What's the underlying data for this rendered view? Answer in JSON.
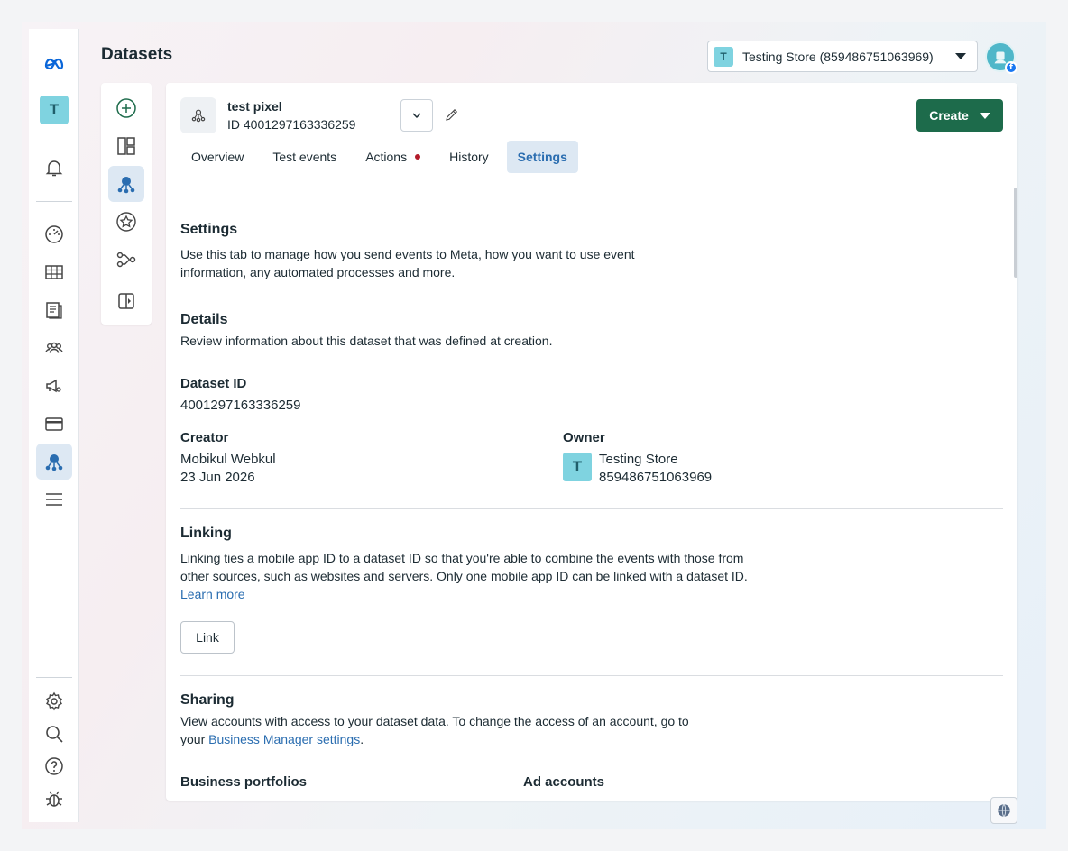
{
  "header": {
    "title": "Datasets",
    "store_selector": "Testing Store (859486751063969)",
    "store_initial": "T"
  },
  "leftnav": {
    "account_initial": "T",
    "items": [
      "meta-logo-icon",
      "account-avatar",
      "notifications-icon",
      "dashboard-icon",
      "table-icon",
      "pages-icon",
      "audiences-icon",
      "ads-icon",
      "billing-icon",
      "events-manager-icon",
      "menu-icon",
      "settings-icon",
      "search-icon",
      "help-icon",
      "bug-icon"
    ]
  },
  "dataset": {
    "name": "test pixel",
    "id_line": "ID 4001297163336259"
  },
  "toolbar": {
    "create_label": "Create"
  },
  "tabs": [
    {
      "label": "Overview"
    },
    {
      "label": "Test events"
    },
    {
      "label": "Actions"
    },
    {
      "label": "History"
    },
    {
      "label": "Settings"
    }
  ],
  "settings": {
    "title": "Settings",
    "description_line1": "Use this tab to manage how you send events to Meta, how you want to use event",
    "description_line2": "information, any automated processes and more."
  },
  "details": {
    "title": "Details",
    "description": "Review information about this dataset that was defined at creation.",
    "dataset_id_label": "Dataset ID",
    "dataset_id_value": "4001297163336259",
    "creator_label": "Creator",
    "creator_name": "Mobikul Webkul",
    "creator_date": "23 Jun 2026",
    "owner_label": "Owner",
    "owner_initial": "T",
    "owner_name": "Testing Store",
    "owner_id": "859486751063969"
  },
  "linking": {
    "title": "Linking",
    "line1": "Linking ties a mobile app ID to a dataset ID so that you're able to combine the events with those from",
    "line2": "other sources, such as websites and servers. Only one mobile app ID can be linked with a dataset ID.",
    "learn_more": "Learn more",
    "button": "Link"
  },
  "sharing": {
    "title": "Sharing",
    "line1": "View accounts with access to your dataset data. To change the access of an account, go to",
    "line2_prefix": "your ",
    "line2_link": "Business Manager settings",
    "line2_suffix": ".",
    "business_portfolios": "Business portfolios",
    "ad_accounts": "Ad accounts"
  },
  "colors": {
    "accent": "#2a6db0",
    "create_button": "#1d6b4b",
    "avatar": "#7fd3e0",
    "notification_dot": "#b31b2a"
  }
}
